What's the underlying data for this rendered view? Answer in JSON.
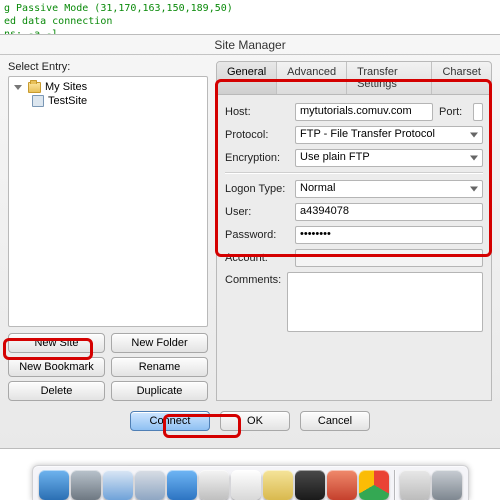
{
  "terminal": {
    "line1": "g Passive Mode (31,170,163,150,189,50)",
    "line2": "ed data connection",
    "line3": "ns: -a -l"
  },
  "window": {
    "title": "Site Manager"
  },
  "left": {
    "select_label": "Select Entry:",
    "root_label": "My Sites",
    "child_label": "TestSite",
    "buttons": {
      "new_site": "New Site",
      "new_folder": "New Folder",
      "new_bookmark": "New Bookmark",
      "rename": "Rename",
      "delete": "Delete",
      "duplicate": "Duplicate"
    }
  },
  "tabs": {
    "general": "General",
    "advanced": "Advanced",
    "transfer": "Transfer Settings",
    "charset": "Charset"
  },
  "form": {
    "host_label": "Host:",
    "host_value": "mytutorials.comuv.com",
    "port_label": "Port:",
    "port_value": "",
    "protocol_label": "Protocol:",
    "protocol_value": "FTP - File Transfer Protocol",
    "encryption_label": "Encryption:",
    "encryption_value": "Use plain FTP",
    "logon_label": "Logon Type:",
    "logon_value": "Normal",
    "user_label": "User:",
    "user_value": "a4394078",
    "password_label": "Password:",
    "password_value": "••••••••",
    "account_label": "Account:",
    "account_value": "",
    "comments_label": "Comments:"
  },
  "bottom": {
    "connect": "Connect",
    "ok": "OK",
    "cancel": "Cancel"
  },
  "dock": {
    "apps": [
      {
        "name": "finder-app-icon",
        "bg": "linear-gradient(#6fb4ef,#2b6fb3)"
      },
      {
        "name": "mail-app-icon",
        "bg": "linear-gradient(#b9c3cc,#6e7882)"
      },
      {
        "name": "safari-app-icon",
        "bg": "linear-gradient(#dbe7f5,#6fa2d9)"
      },
      {
        "name": "itunes-app-icon",
        "bg": "linear-gradient(#d9dee5,#8ea6c3)"
      },
      {
        "name": "app-store-icon",
        "bg": "linear-gradient(#6fb6f5,#2d74c2)"
      },
      {
        "name": "preview-app-icon",
        "bg": "linear-gradient(#f4f4f4,#bfbfbf)"
      },
      {
        "name": "calendar-app-icon",
        "bg": "linear-gradient(#ffffff,#d8d8d8)"
      },
      {
        "name": "notes-app-icon",
        "bg": "linear-gradient(#f5e49a,#d9b94e)"
      },
      {
        "name": "terminal-app-icon",
        "bg": "linear-gradient(#4a4a4a,#1a1a1a)"
      },
      {
        "name": "photobooth-app-icon",
        "bg": "linear-gradient(#f08a6c,#c5402d)"
      },
      {
        "name": "chrome-app-icon",
        "bg": "conic-gradient(#ea4335 0 120deg,#34a853 120deg 240deg,#fbbc05 240deg 360deg)"
      },
      {
        "name": "generic-app-icon",
        "bg": "linear-gradient(#e8e8e8,#bcbcbc)"
      },
      {
        "name": "settings-app-icon",
        "bg": "linear-gradient(#c8cdd3,#7e8790)"
      }
    ]
  }
}
